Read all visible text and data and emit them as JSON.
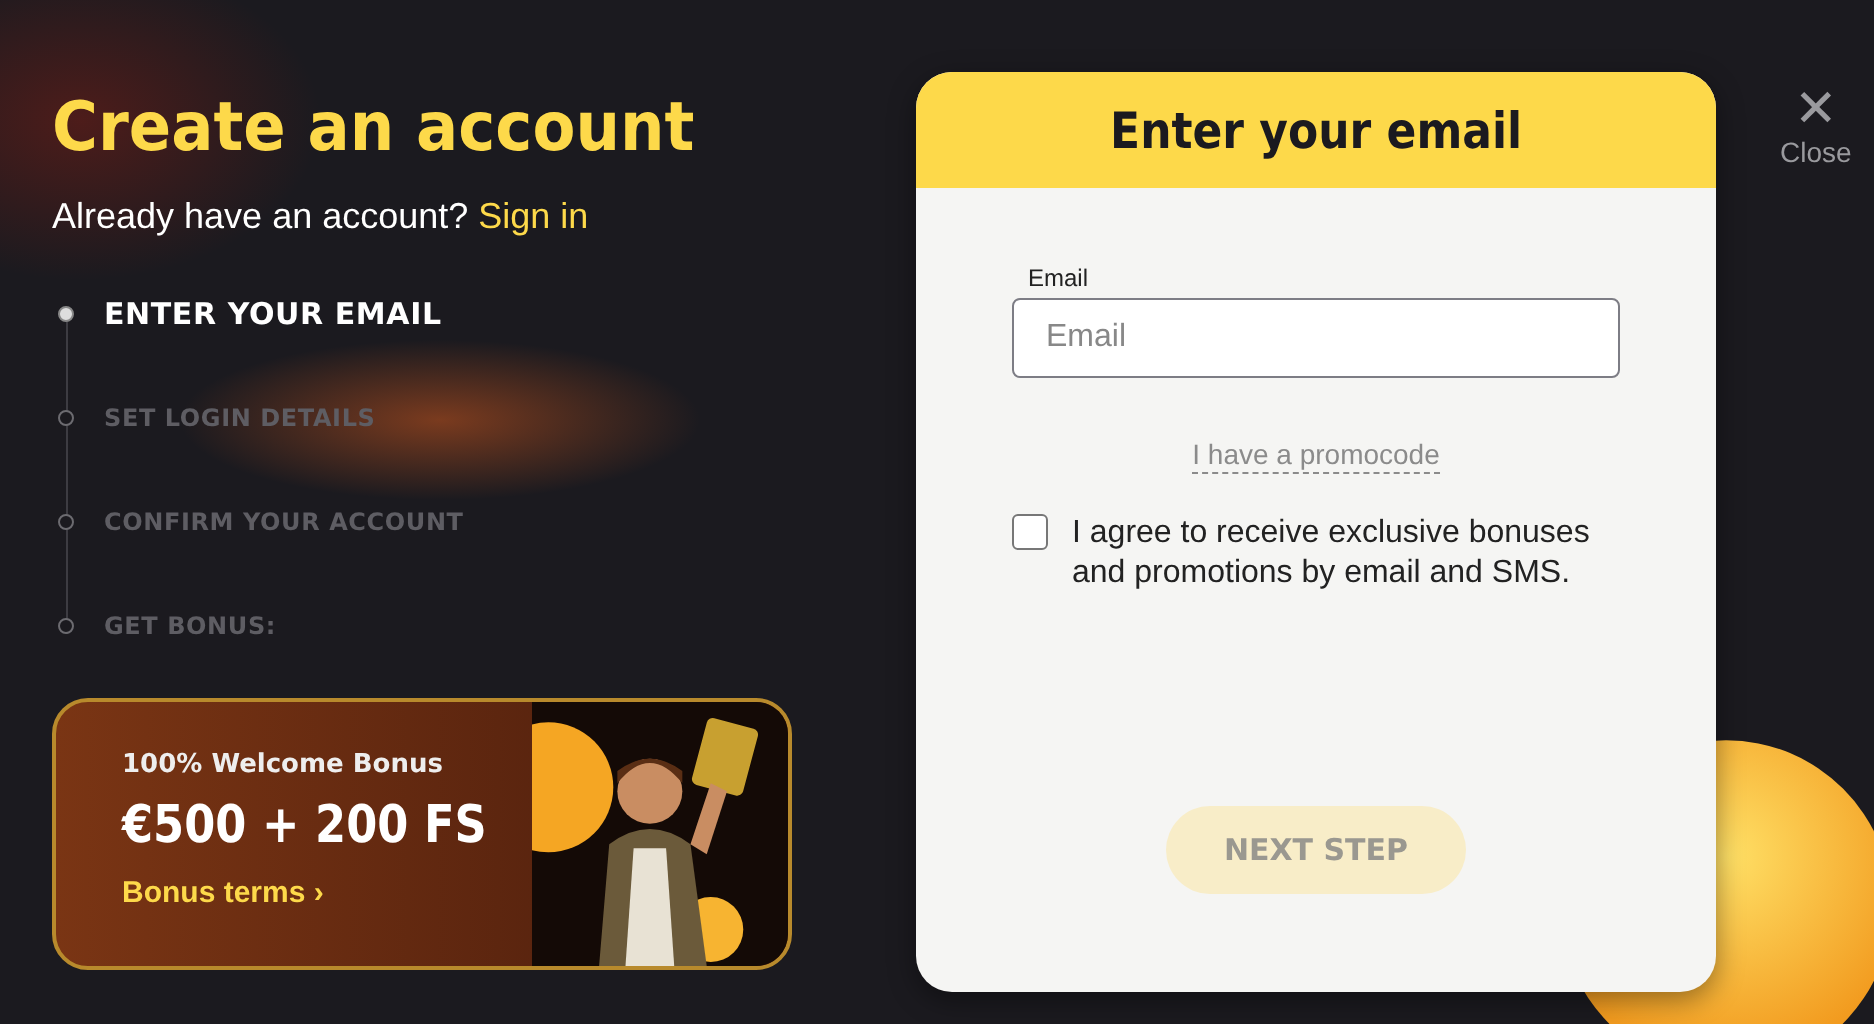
{
  "page": {
    "title": "Create an account",
    "signin_prompt": "Already have an account?",
    "signin_link": "Sign in"
  },
  "steps": [
    {
      "label": "ENTER YOUR EMAIL",
      "selected": true
    },
    {
      "label": "SET LOGIN DETAILS",
      "selected": false
    },
    {
      "label": "CONFIRM YOUR ACCOUNT",
      "selected": false
    },
    {
      "label": "GET BONUS:",
      "selected": false
    }
  ],
  "bonus": {
    "kind": "picture",
    "subtitle": "100% Welcome Bonus",
    "amount": "€500 + 200 FS",
    "terms_link": "Bonus terms",
    "terms_arrow": "›"
  },
  "modal": {
    "title": "Enter your email",
    "email_label": "Email",
    "email_placeholder": "Email",
    "promocode_link": "I have a promocode",
    "consent": {
      "text": "I agree to receive exclusive bonuses and promotions by email and SMS.",
      "checked": false
    },
    "next_button": {
      "label": "NEXT STEP",
      "disabled": true
    }
  },
  "close": {
    "icon": "✕",
    "label": "Close"
  }
}
